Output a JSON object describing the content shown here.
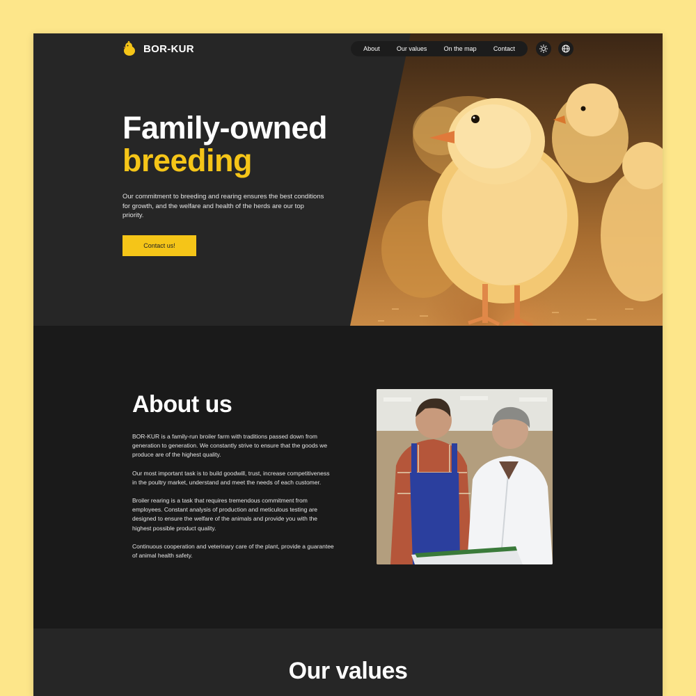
{
  "brand": {
    "name": "BOR-KUR",
    "icon": "chick-logo-icon"
  },
  "nav": {
    "items": [
      "About",
      "Our values",
      "On the map",
      "Contact"
    ]
  },
  "header_icons": {
    "theme": "sun-icon",
    "language": "globe-icon"
  },
  "hero": {
    "title_line1": "Family-owned",
    "title_line2": "breeding",
    "description": "Our commitment to breeding and rearing ensures the best conditions for growth, and the welfare and health of the herds are our top priority.",
    "cta_label": "Contact us!",
    "image": "chicks-photo"
  },
  "about": {
    "title": "About us",
    "paragraphs": [
      "BOR-KUR is a family-run broiler farm with traditions passed down from generation to generation. We constantly strive to ensure that the goods we produce are of the highest quality.",
      "Our most important task is to build goodwill, trust, increase competitiveness in the poultry market, understand and meet the needs of each customer.",
      "Broiler rearing is a task that requires tremendous commitment from employees. Constant analysis of production and meticulous testing are designed to ensure the welfare of the animals and provide you with the highest possible product quality.",
      "Continuous cooperation and veterinary care of the plant, provide a guarantee of animal health safety."
    ],
    "image": "farmer-and-vet-photo"
  },
  "values": {
    "title": "Our values"
  },
  "colors": {
    "accent": "#f5c518",
    "page_bg": "#fde68a",
    "hero_bg": "#262626",
    "section_bg": "#1a1a1a",
    "text": "#ffffff"
  }
}
